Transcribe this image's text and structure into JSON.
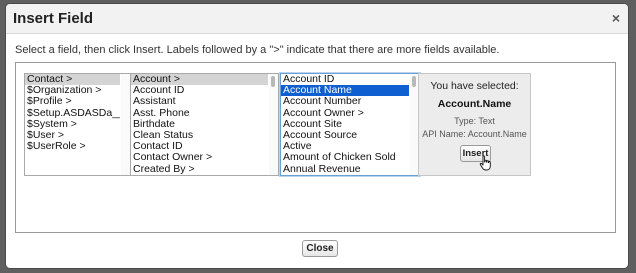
{
  "dialog": {
    "title": "Insert Field",
    "close_glyph": "×",
    "close_icon": "close-icon",
    "instructions": "Select a field, then click Insert. Labels followed by a \">\" indicate that there are more fields available.",
    "close_button_label": "Close"
  },
  "lists": {
    "objects": [
      "Contact >",
      "$Organization >",
      "$Profile >",
      "$Setup.ASDASDa__c >",
      "$System >",
      "$User >",
      "$UserRole >"
    ],
    "contact_fields": [
      "Account >",
      "Account ID",
      "Assistant",
      "Asst. Phone",
      "Birthdate",
      "Clean Status",
      "Contact ID",
      "Contact Owner >",
      "Created By >"
    ],
    "account_fields": [
      "Account ID",
      "Account Name",
      "Account Number",
      "Account Owner >",
      "Account Site",
      "Account Source",
      "Active",
      "Amount of Chicken Sold",
      "Annual Revenue"
    ]
  },
  "selection": {
    "objects_selected": "Contact >",
    "contact_fields_selected": "Account >",
    "account_fields_selected": "Account Name"
  },
  "info_panel": {
    "selected_label": "You have selected:",
    "field_name": "Account.Name",
    "type": "Type: Text",
    "api_name": "API Name: Account.Name",
    "insert_label": "Insert"
  },
  "colors": {
    "selection_blue": "#0f5fd1",
    "selection_gray": "#d4d4d4",
    "backdrop": "#5f5f5f"
  }
}
